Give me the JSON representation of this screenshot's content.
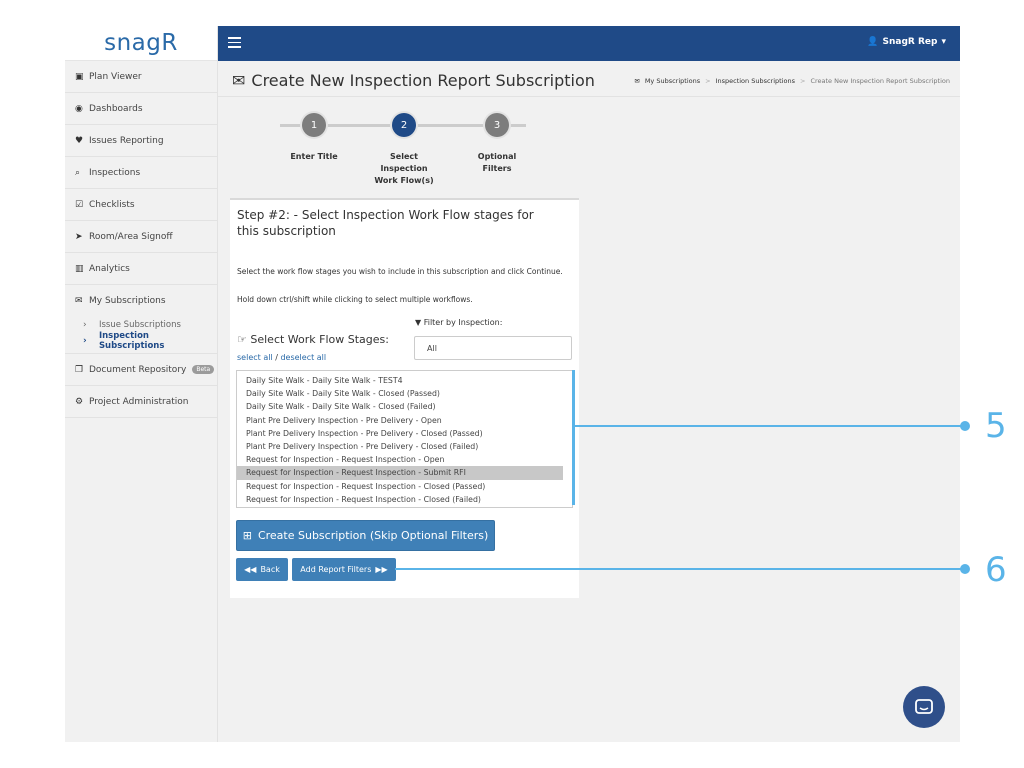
{
  "logo": {
    "text": "snagR"
  },
  "topbar": {
    "user_label": "SnagR Rep"
  },
  "sidebar": {
    "items": [
      {
        "label": "Plan Viewer",
        "icon": "image-icon"
      },
      {
        "label": "Dashboards",
        "icon": "dashboard-icon"
      },
      {
        "label": "Issues Reporting",
        "icon": "map-marker-icon"
      },
      {
        "label": "Inspections",
        "icon": "search-icon"
      },
      {
        "label": "Checklists",
        "icon": "checkbox-icon"
      },
      {
        "label": "Room/Area Signoff",
        "icon": "location-arrow-icon"
      },
      {
        "label": "Analytics",
        "icon": "bar-chart-icon"
      },
      {
        "label": "My Subscriptions",
        "icon": "envelope-icon"
      }
    ],
    "sub_items": [
      {
        "label": "Issue Subscriptions"
      },
      {
        "label": "Inspection Subscriptions"
      }
    ],
    "bottom_items": [
      {
        "label": "Document Repository",
        "icon": "copy-icon",
        "badge": "Beta"
      },
      {
        "label": "Project Administration",
        "icon": "cogs-icon"
      }
    ]
  },
  "header": {
    "title": "Create New Inspection Report Subscription",
    "breadcrumb": [
      "My Subscriptions",
      "Inspection Subscriptions",
      "Create New Inspection Report Subscription"
    ]
  },
  "wizard": {
    "steps": [
      {
        "number": "1",
        "label": "Enter Title"
      },
      {
        "number": "2",
        "label": "Select Inspection Work Flow(s)"
      },
      {
        "number": "3",
        "label": "Optional Filters"
      }
    ]
  },
  "card": {
    "title": "Step #2: - Select Inspection Work Flow stages for this subscription",
    "instruction1": "Select the work flow stages you wish to include in this subscription and click Continue.",
    "instruction2": "Hold down ctrl/shift while clicking to select multiple workflows.",
    "filter_label": "Filter by Inspection:",
    "filter_value": "All",
    "stages_label": "Select Work Flow Stages:",
    "select_all": "select all",
    "deselect_all": "deselect all",
    "workflows": [
      "Daily Site Walk - Daily Site Walk - TEST4",
      "Daily Site Walk - Daily Site Walk - Closed (Passed)",
      "Daily Site Walk - Daily Site Walk - Closed (Failed)",
      "Plant Pre Delivery Inspection - Pre Delivery - Open",
      "Plant Pre Delivery Inspection - Pre Delivery - Closed (Passed)",
      "Plant Pre Delivery Inspection - Pre Delivery - Closed (Failed)",
      "Request for Inspection - Request Inspection - Open",
      "Request for Inspection - Request Inspection - Submit RFI",
      "Request for Inspection - Request Inspection - Closed (Passed)",
      "Request for Inspection - Request Inspection - Closed (Failed)"
    ],
    "selected_workflow": "Request for Inspection - Request Inspection - Submit RFI",
    "create_label": "Create Subscription (Skip Optional Filters)",
    "back_label": "Back",
    "filters_label": "Add Report Filters"
  },
  "callouts": {
    "five": "5",
    "six": "6"
  },
  "colors": {
    "primary": "#1f4a87",
    "button": "#3f80b7",
    "callout": "#5ab4e8"
  }
}
